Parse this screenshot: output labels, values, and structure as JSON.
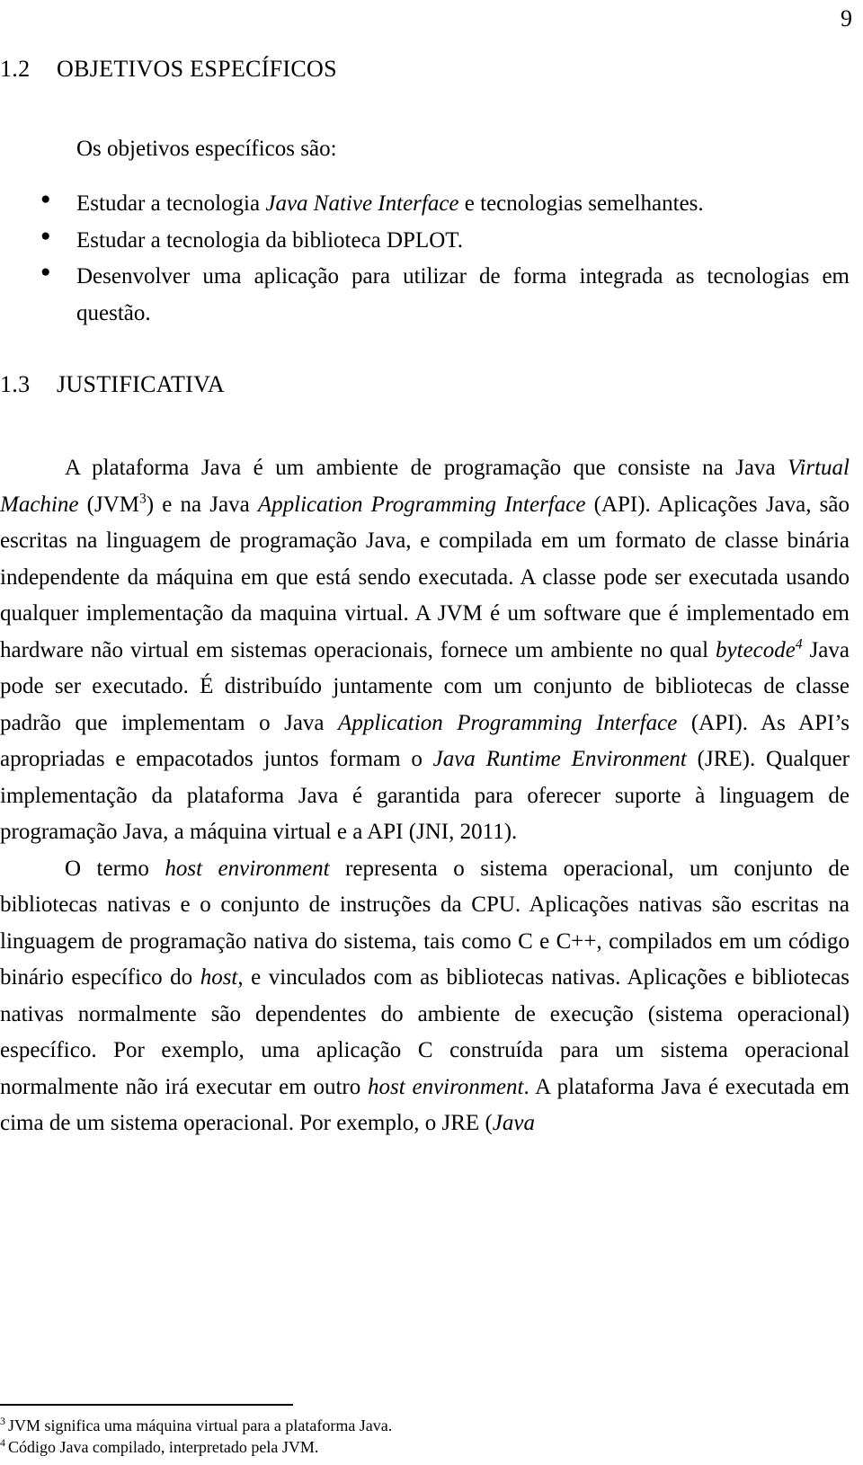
{
  "page": {
    "number": "9"
  },
  "sections": [
    {
      "number": "1.2",
      "title": "OBJETIVOS ESPECÍFICOS",
      "lead": "Os objetivos específicos são:",
      "bullets": [
        {
          "parts": [
            {
              "text": "Estudar a tecnologia ",
              "style": "normal"
            },
            {
              "text": "Java Native Interface",
              "style": "italic"
            },
            {
              "text": " e tecnologias semelhantes.",
              "style": "normal"
            }
          ]
        },
        {
          "parts": [
            {
              "text": "Estudar a tecnologia da biblioteca DPLOT.",
              "style": "normal"
            }
          ]
        },
        {
          "parts": [
            {
              "text": "Desenvolver uma aplicação para utilizar de forma integrada as tecnologias em questão.",
              "style": "normal"
            }
          ]
        }
      ]
    },
    {
      "number": "1.3",
      "title": "JUSTIFICATIVA",
      "paragraphs": [
        {
          "parts": [
            {
              "text": "A plataforma Java é um ambiente de programação que consiste na Java ",
              "style": "normal"
            },
            {
              "text": "Virtual Machine",
              "style": "italic"
            },
            {
              "text": " (JVM",
              "style": "normal"
            },
            {
              "text": "3",
              "style": "superscript"
            },
            {
              "text": ") e na Java ",
              "style": "normal"
            },
            {
              "text": "Application Programming Interface",
              "style": "italic"
            },
            {
              "text": " (API). Aplicações Java, são escritas na linguagem de programação Java, e compilada em um formato de classe binária independente da máquina em que está sendo executada. A classe pode ser executada usando qualquer implementação da maquina virtual. A JVM é um software que é implementado em hardware não virtual em sistemas operacionais, fornece um ambiente no qual ",
              "style": "normal"
            },
            {
              "text": "bytecode",
              "style": "italic"
            },
            {
              "text": "4",
              "style": "superscript-italic"
            },
            {
              "text": " Java pode ser executado. É distribuído juntamente com um conjunto de bibliotecas de classe padrão que implementam o Java ",
              "style": "normal"
            },
            {
              "text": "Application Programming Interface",
              "style": "italic"
            },
            {
              "text": " (API). As API’s apropriadas e empacotados juntos formam o ",
              "style": "normal"
            },
            {
              "text": "Java Runtime Environment",
              "style": "italic"
            },
            {
              "text": " (JRE). Qualquer implementação da plataforma Java é garantida para oferecer suporte à linguagem de programação Java, a máquina virtual e a API (JNI, 2011).",
              "style": "normal"
            }
          ]
        },
        {
          "parts": [
            {
              "text": "O termo ",
              "style": "normal"
            },
            {
              "text": "host environment",
              "style": "italic"
            },
            {
              "text": " representa o sistema operacional, um conjunto de bibliotecas nativas e o conjunto de instruções da CPU. Aplicações nativas são escritas na linguagem de programação nativa do sistema, tais como C e C++, compilados em um código binário específico do ",
              "style": "normal"
            },
            {
              "text": "host",
              "style": "italic"
            },
            {
              "text": ", e vinculados com as bibliotecas nativas. Aplicações e bibliotecas nativas normalmente são dependentes do ambiente de execução (sistema operacional) específico. Por exemplo, uma aplicação C construída para um sistema operacional normalmente não irá executar em outro ",
              "style": "normal"
            },
            {
              "text": "host environment",
              "style": "italic"
            },
            {
              "text": ". A plataforma Java é executada em cima de um sistema operacional. Por exemplo, o JRE (",
              "style": "normal"
            },
            {
              "text": "Java",
              "style": "italic"
            }
          ]
        }
      ]
    }
  ],
  "footnotes": [
    {
      "mark": "3",
      "text": "JVM significa uma máquina virtual para a plataforma Java."
    },
    {
      "mark": "4",
      "text": "Código Java compilado, interpretado pela JVM."
    }
  ]
}
